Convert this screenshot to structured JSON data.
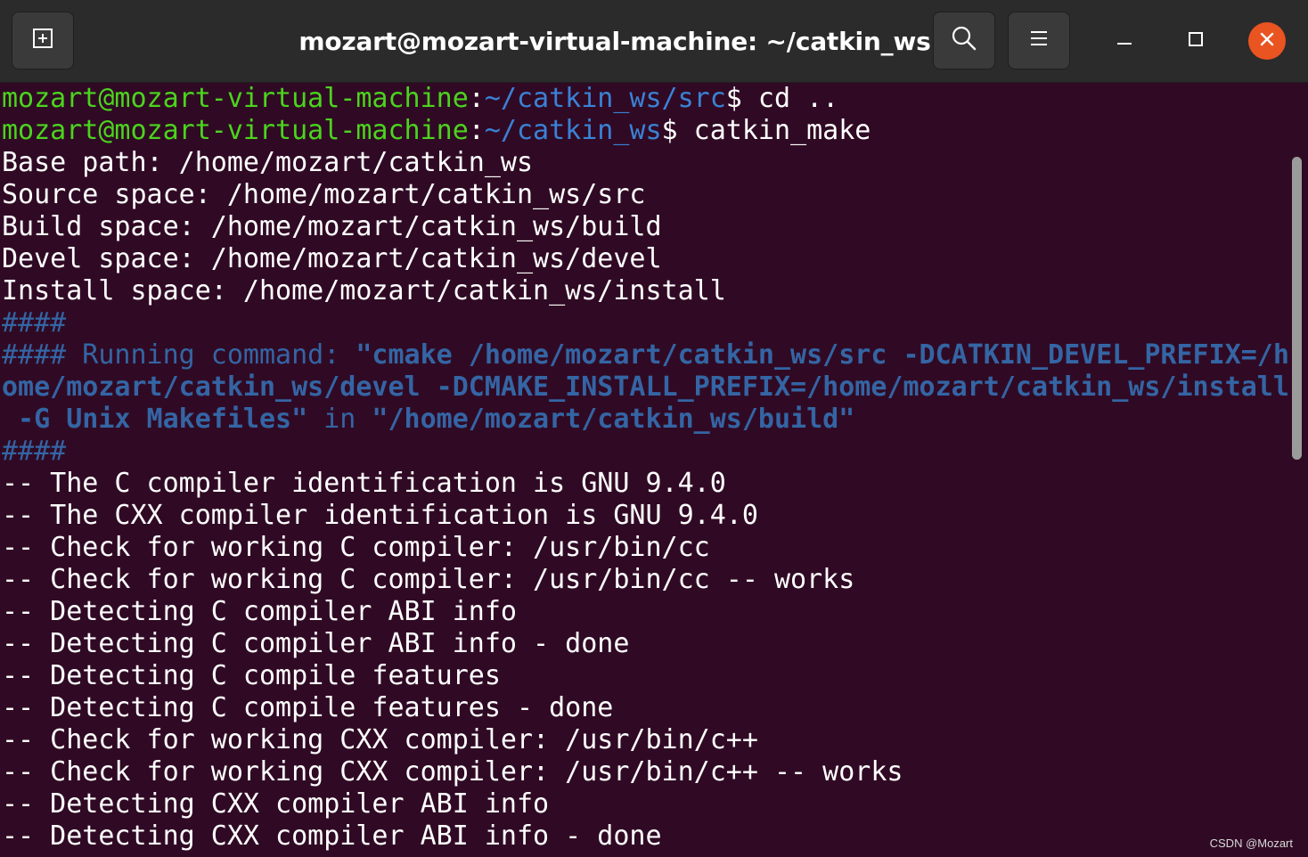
{
  "window": {
    "title": "mozart@mozart-virtual-machine: ~/catkin_ws"
  },
  "icons": {
    "new_tab": "new-tab-icon",
    "search": "search-icon",
    "menu": "hamburger-menu-icon",
    "minimize": "minimize-icon",
    "maximize": "maximize-icon",
    "close": "close-icon"
  },
  "colors": {
    "background": "#300a24",
    "prompt_user": "#4bd41e",
    "prompt_path": "#3a82d6",
    "cmake_info": "#3465a4",
    "close_button": "#e95420"
  },
  "terminal": {
    "prompt1": {
      "user": "mozart@mozart-virtual-machine",
      "sep": ":",
      "path": "~/catkin_ws/src",
      "dollar": "$ ",
      "command": "cd .."
    },
    "prompt2": {
      "user": "mozart@mozart-virtual-machine",
      "sep": ":",
      "path": "~/catkin_ws",
      "dollar": "$ ",
      "command": "catkin_make"
    },
    "spaces": [
      "Base path: /home/mozart/catkin_ws",
      "Source space: /home/mozart/catkin_ws/src",
      "Build space: /home/mozart/catkin_ws/build",
      "Devel space: /home/mozart/catkin_ws/devel",
      "Install space: /home/mozart/catkin_ws/install"
    ],
    "hash1": "####",
    "running": {
      "prefix": "#### Running command: ",
      "cmd_line1": "\"cmake /home/mozart/catkin_ws/src -DCATKIN_DEVEL_PREFIX=/h",
      "cmd_line2": "ome/mozart/catkin_ws/devel -DCMAKE_INSTALL_PREFIX=/home/mozart/catkin_ws/install",
      "cmd_line3": " -G Unix Makefiles\"",
      "in": " in ",
      "dir": "\"/home/mozart/catkin_ws/build\""
    },
    "hash2": "####",
    "output": [
      "-- The C compiler identification is GNU 9.4.0",
      "-- The CXX compiler identification is GNU 9.4.0",
      "-- Check for working C compiler: /usr/bin/cc",
      "-- Check for working C compiler: /usr/bin/cc -- works",
      "-- Detecting C compiler ABI info",
      "-- Detecting C compiler ABI info - done",
      "-- Detecting C compile features",
      "-- Detecting C compile features - done",
      "-- Check for working CXX compiler: /usr/bin/c++",
      "-- Check for working CXX compiler: /usr/bin/c++ -- works",
      "-- Detecting CXX compiler ABI info",
      "-- Detecting CXX compiler ABI info - done"
    ]
  },
  "watermark": "CSDN @Mozart"
}
